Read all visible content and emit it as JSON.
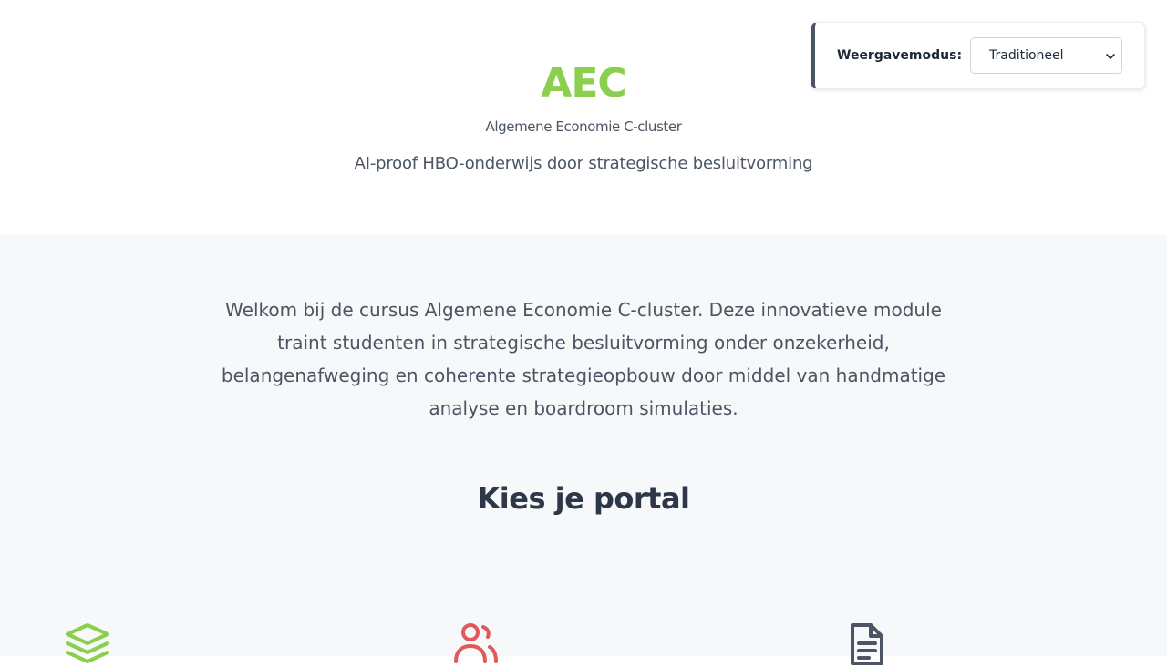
{
  "header": {
    "logo": "AEC",
    "subtitle": "Algemene Economie C-cluster",
    "tagline": "AI-proof HBO-onderwijs door strategische besluitvorming"
  },
  "display_mode": {
    "label": "Weergavemodus:",
    "selected": "Traditioneel"
  },
  "main": {
    "intro": "Welkom bij de cursus Algemene Economie C-cluster. Deze innovatieve module traint studenten in strategische besluitvorming onder onzekerheid, belangenafweging en coherente strategieopbouw door middel van handmatige analyse en boardroom simulaties.",
    "section_title": "Kies je portal"
  },
  "portals": [
    {
      "icon": "layers-icon",
      "color": "#8cce4e"
    },
    {
      "icon": "users-icon",
      "color": "#e05a5a"
    },
    {
      "icon": "document-icon",
      "color": "#4b5563"
    }
  ],
  "colors": {
    "brand_green": "#8cce4e",
    "accent_red": "#e05a5a",
    "text_dark": "#2d3748",
    "text_muted": "#4b5563",
    "section_bg": "#f7f8fa"
  }
}
